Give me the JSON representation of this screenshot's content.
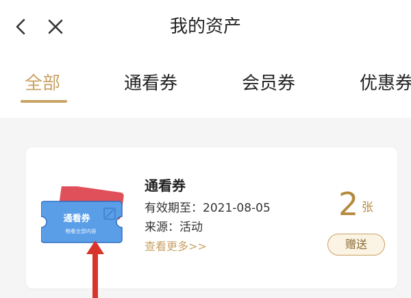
{
  "header": {
    "title": "我的资产",
    "back_icon": "chevron-left-icon",
    "close_icon": "close-icon"
  },
  "tabs": [
    {
      "label": "全部",
      "active": true
    },
    {
      "label": "通看券",
      "active": false
    },
    {
      "label": "会员券",
      "active": false
    },
    {
      "label": "优惠券",
      "active": false
    }
  ],
  "card": {
    "title": "通看券",
    "validity": "有效期至：2021-08-05",
    "source": "来源：活动",
    "view_more": "查看更多>>",
    "count": "2",
    "count_unit": "张",
    "gift_button": "赠送",
    "ticket_image": {
      "label": "通看券",
      "sublabel": "畅看全部内容"
    }
  },
  "colors": {
    "accent": "#c9a264",
    "count": "#b58a3e",
    "ticket_blue": "#5a9ee8",
    "ticket_red": "#e0505a",
    "annotation_arrow": "#d9342b"
  }
}
